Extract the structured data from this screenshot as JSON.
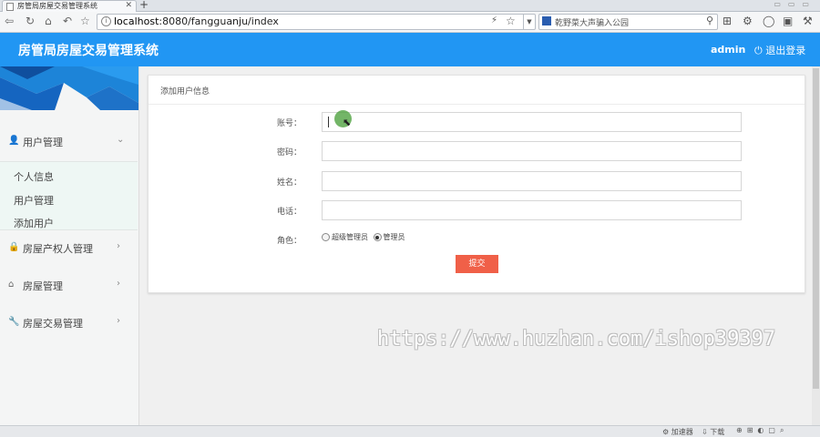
{
  "browser": {
    "tab_title": "房管局房屋交易管理系统",
    "tab_close": "✕",
    "new_tab": "+",
    "url_host": "localhost",
    "url_rest": ":8080/fangguanju/index",
    "search_text": "乾野菜大声骗入公园"
  },
  "header": {
    "app_name": "房管局房屋交易管理系统",
    "user": "admin",
    "logout": "退出登录"
  },
  "sidebar": {
    "menus": [
      {
        "label": "用户管理",
        "icon": "user-icon",
        "arrow": "⌄"
      },
      {
        "label": "房屋产权人管理",
        "icon": "lock-icon",
        "arrow": "›"
      },
      {
        "label": "房屋管理",
        "icon": "home-icon",
        "arrow": "›"
      },
      {
        "label": "房屋交易管理",
        "icon": "wrench-icon",
        "arrow": "›"
      }
    ],
    "submenu": [
      "个人信息",
      "用户管理",
      "添加用户"
    ]
  },
  "panel": {
    "title": "添加用户信息",
    "fields": [
      {
        "label": "账号："
      },
      {
        "label": "密码："
      },
      {
        "label": "姓名："
      },
      {
        "label": "电话："
      }
    ],
    "role_label": "角色：",
    "roles": [
      {
        "label": "超级管理员",
        "checked": false
      },
      {
        "label": "管理员",
        "checked": true
      }
    ],
    "submit": "提交"
  },
  "watermark": "https://www.huzhan.com/ishop39397",
  "statusbar": {
    "accelerator": "加速器",
    "download": "下载"
  },
  "colors": {
    "header": "#2196f3",
    "submit": "#f06048",
    "submenu_bg": "#eef7f4"
  }
}
